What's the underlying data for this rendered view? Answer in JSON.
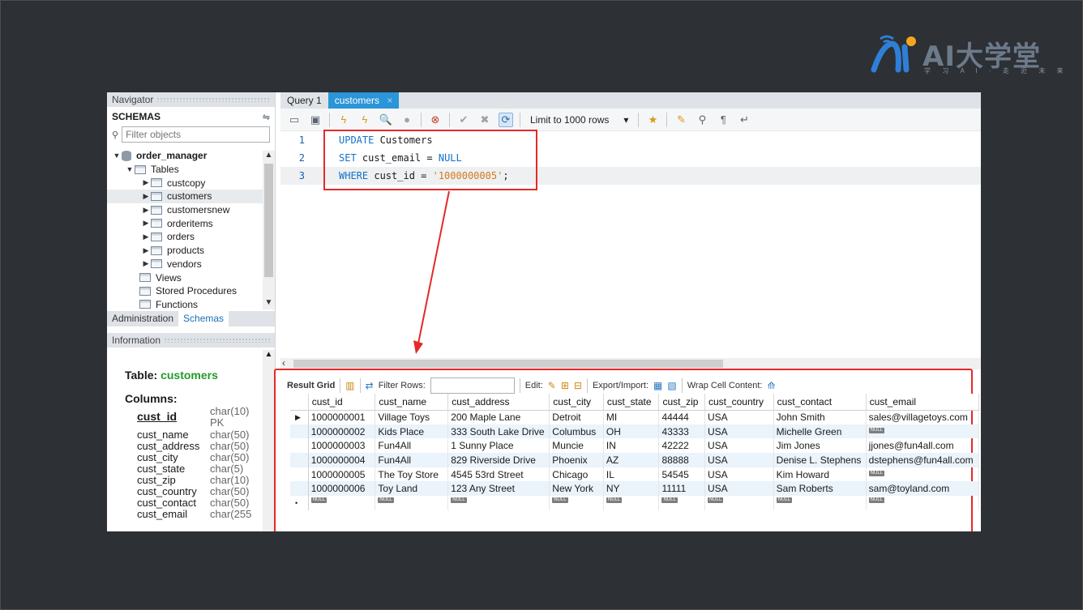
{
  "logo": {
    "text": "AI大学堂",
    "sub": "学 习 A I · 走 近 未 来"
  },
  "navigator": {
    "header": "Navigator",
    "schemas_title": "SCHEMAS",
    "filter_placeholder": "Filter objects",
    "tree": {
      "schema": "order_manager",
      "tables_label": "Tables",
      "tables": [
        "custcopy",
        "customers",
        "customersnew",
        "orderitems",
        "orders",
        "products",
        "vendors"
      ],
      "selected": "customers",
      "others": [
        "Views",
        "Stored Procedures",
        "Functions"
      ]
    },
    "bottom_tabs": [
      "Administration",
      "Schemas"
    ],
    "active_tab": "Schemas"
  },
  "information": {
    "header": "Information",
    "table_label": "Table:",
    "table_name": "customers",
    "columns_label": "Columns:",
    "columns": [
      {
        "name": "cust_id",
        "type": "char(10)",
        "extra": "PK"
      },
      {
        "name": "cust_name",
        "type": "char(50)"
      },
      {
        "name": "cust_address",
        "type": "char(50)"
      },
      {
        "name": "cust_city",
        "type": "char(50)"
      },
      {
        "name": "cust_state",
        "type": "char(5)"
      },
      {
        "name": "cust_zip",
        "type": "char(10)"
      },
      {
        "name": "cust_country",
        "type": "char(50)"
      },
      {
        "name": "cust_contact",
        "type": "char(50)"
      },
      {
        "name": "cust_email",
        "type": "char(255"
      }
    ]
  },
  "query_tabs": [
    {
      "label": "Query 1",
      "active": false
    },
    {
      "label": "customers",
      "active": true,
      "close": "×"
    }
  ],
  "toolbar": {
    "limit": "Limit to 1000 rows",
    "limit_arrow": "▾"
  },
  "editor": {
    "lines": [
      {
        "num": "1",
        "kw": "UPDATE",
        "rest": " Customers"
      },
      {
        "num": "2",
        "kw": "SET",
        "rest": " cust_email = ",
        "kw2": "NULL"
      },
      {
        "num": "3",
        "kw": "WHERE",
        "rest": " cust_id = ",
        "str": "'1000000005'",
        "end": ";"
      }
    ]
  },
  "results_toolbar": {
    "result_grid": "Result Grid",
    "filter_rows": "Filter Rows:",
    "edit": "Edit:",
    "export_import": "Export/Import:",
    "wrap": "Wrap Cell Content:"
  },
  "grid": {
    "columns": [
      "cust_id",
      "cust_name",
      "cust_address",
      "cust_city",
      "cust_state",
      "cust_zip",
      "cust_country",
      "cust_contact",
      "cust_email"
    ],
    "rows": [
      [
        "1000000001",
        "Village Toys",
        "200 Maple Lane",
        "Detroit",
        "MI",
        "44444",
        "USA",
        "John Smith",
        "sales@villagetoys.com"
      ],
      [
        "1000000002",
        "Kids Place",
        "333 South Lake Drive",
        "Columbus",
        "OH",
        "43333",
        "USA",
        "Michelle Green",
        null
      ],
      [
        "1000000003",
        "Fun4All",
        "1 Sunny Place",
        "Muncie",
        "IN",
        "42222",
        "USA",
        "Jim Jones",
        "jjones@fun4all.com"
      ],
      [
        "1000000004",
        "Fun4All",
        "829 Riverside Drive",
        "Phoenix",
        "AZ",
        "88888",
        "USA",
        "Denise L. Stephens",
        "dstephens@fun4all.com"
      ],
      [
        "1000000005",
        "The Toy Store",
        "4545 53rd Street",
        "Chicago",
        "IL",
        "54545",
        "USA",
        "Kim Howard",
        null
      ],
      [
        "1000000006",
        "Toy Land",
        "123 Any Street",
        "New York",
        "NY",
        "11111",
        "USA",
        "Sam Roberts",
        "sam@toyland.com"
      ]
    ],
    "null_label": "NULL"
  }
}
